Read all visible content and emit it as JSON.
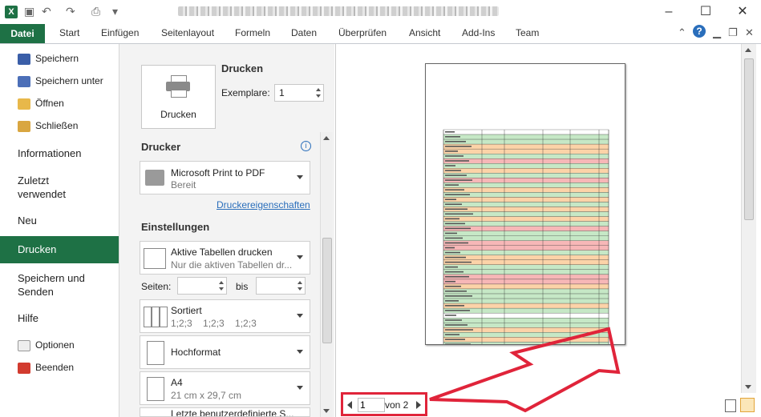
{
  "titlebar": {
    "help_icon": "help-icon",
    "window_buttons": [
      "–",
      "☐",
      "✕"
    ]
  },
  "ribbon": {
    "file_tab": "Datei",
    "tabs": [
      "Start",
      "Einfügen",
      "Seitenlayout",
      "Formeln",
      "Daten",
      "Überprüfen",
      "Ansicht",
      "Add-Ins",
      "Team"
    ]
  },
  "leftnav": {
    "speichern": "Speichern",
    "speichern_unter": "Speichern unter",
    "oeffnen": "Öffnen",
    "schliessen": "Schließen",
    "informationen": "Informationen",
    "zuletzt1": "Zuletzt",
    "zuletzt2": "verwendet",
    "neu": "Neu",
    "drucken": "Drucken",
    "senden1": "Speichern und",
    "senden2": "Senden",
    "hilfe": "Hilfe",
    "optionen": "Optionen",
    "beenden": "Beenden"
  },
  "print": {
    "print_button_label": "Drucken",
    "heading": "Drucken",
    "copies_label": "Exemplare:",
    "copies_value": "1",
    "printer_heading": "Drucker",
    "printer_name": "Microsoft Print to PDF",
    "printer_status": "Bereit",
    "printer_props": "Druckereigenschaften",
    "settings_heading": "Einstellungen",
    "scope_title": "Aktive Tabellen drucken",
    "scope_sub": "Nur die aktiven Tabellen dr...",
    "pages_label": "Seiten:",
    "bis_label": "bis",
    "collate_title": "Sortiert",
    "collate_sub": "1;2;3    1;2;3    1;2;3",
    "orientation": "Hochformat",
    "paper_title": "A4",
    "paper_sub": "21 cm x 29,7 cm",
    "cut_text": "Letzte benutzerdefinierte S..."
  },
  "preview": {
    "current_page": "1",
    "page_total": "von 2"
  },
  "colors": {
    "accent": "#1e7145",
    "highlight": "#e0243a"
  }
}
